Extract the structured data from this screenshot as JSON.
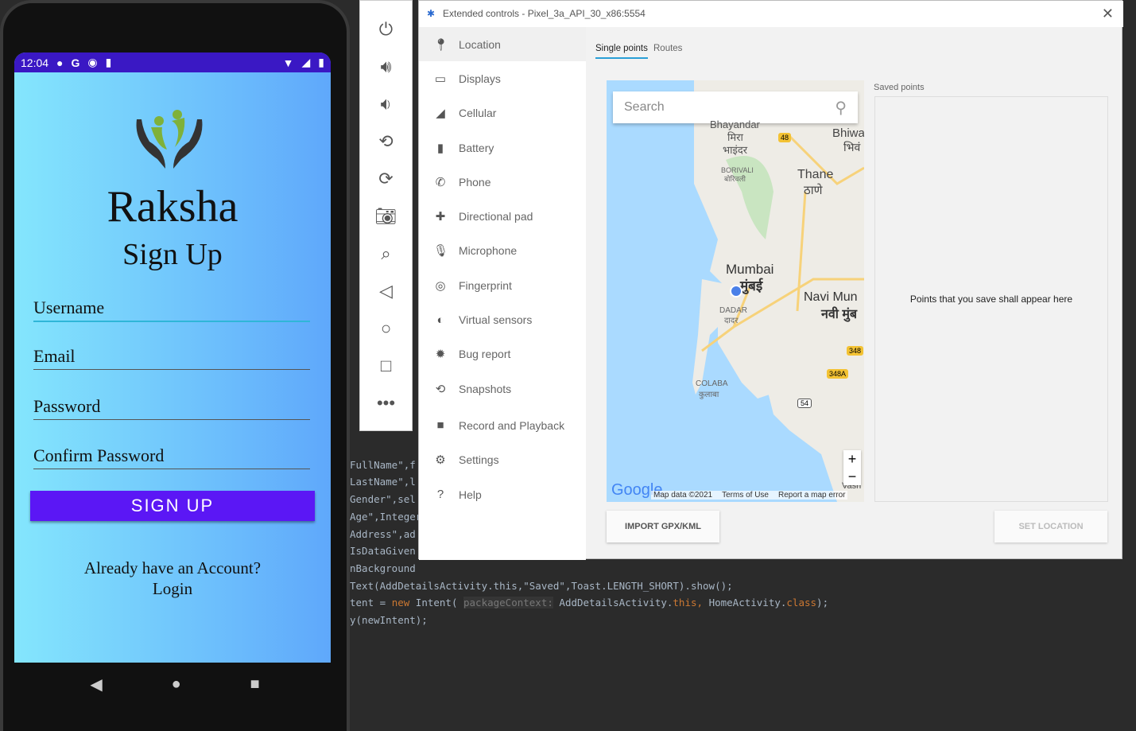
{
  "phone": {
    "time": "12:04",
    "app_name": "Raksha",
    "page_title": "Sign Up",
    "fields": [
      {
        "label": "Username"
      },
      {
        "label": "Email"
      },
      {
        "label": "Password"
      },
      {
        "label": "Confirm Password"
      }
    ],
    "signup_button": "SIGN UP",
    "login_prompt": "Already have an Account?",
    "login_link": "Login"
  },
  "code": {
    "lines": [
      "FullName\",f",
      "LastName\",l",
      "Gender\",sel",
      "Age\",Integer",
      "Address\",ad",
      "IsDataGiven",
      "nBackground"
    ],
    "line_toast": "Text(AddDetailsActivity.this,\"Saved\",Toast.LENGTH_SHORT).show();",
    "line_intent_a": "tent = ",
    "line_intent_new": "new",
    "line_intent_b": " Intent( ",
    "line_intent_hint": "packageContext:",
    "line_intent_c": " AddDetailsActivity.",
    "line_intent_this": "this,",
    "line_intent_d": " HomeActivity.",
    "line_intent_class": "class",
    "line_intent_e": ");",
    "line_start": "y(newIntent);"
  },
  "extended_controls": {
    "title": "Extended controls - Pixel_3a_API_30_x86:5554",
    "menu": [
      {
        "label": "Location",
        "icon": "location-pin-icon"
      },
      {
        "label": "Displays",
        "icon": "display-icon"
      },
      {
        "label": "Cellular",
        "icon": "cellular-icon"
      },
      {
        "label": "Battery",
        "icon": "battery-icon"
      },
      {
        "label": "Phone",
        "icon": "phone-icon"
      },
      {
        "label": "Directional pad",
        "icon": "dpad-icon"
      },
      {
        "label": "Microphone",
        "icon": "microphone-icon"
      },
      {
        "label": "Fingerprint",
        "icon": "fingerprint-icon"
      },
      {
        "label": "Virtual sensors",
        "icon": "sensors-icon"
      },
      {
        "label": "Bug report",
        "icon": "bug-icon"
      },
      {
        "label": "Snapshots",
        "icon": "snapshot-icon"
      },
      {
        "label": "Record and Playback",
        "icon": "video-icon"
      },
      {
        "label": "Settings",
        "icon": "gear-icon"
      },
      {
        "label": "Help",
        "icon": "help-icon"
      }
    ],
    "selected": "Location",
    "tabs": [
      "Single points",
      "Routes"
    ],
    "active_tab": "Single points",
    "search_placeholder": "Search",
    "map_labels": {
      "mumbai": "Mumbai",
      "mumbai_hi": "मुंबई",
      "thane": "Thane",
      "thane_hi": "ठाणे",
      "navi": "Navi Mun",
      "navi_hi": "नवी मुंब",
      "bhiwandi": "Bhiwa",
      "bhiwandi_hi": "भिवं",
      "bhayandar": "Bhayandar",
      "mira_hi": "मिरा",
      "bhayandar_hi": "भाइंदर",
      "borivali": "BORIVALI",
      "borivali_hi": "बोरिवली",
      "dadar": "DADAR",
      "dadar_hi": "दादर",
      "colaba": "COLABA",
      "colaba_hi": "कुलाबा",
      "vashi": "Vash",
      "r48": "48",
      "r348": "348",
      "r348a": "348A",
      "r54": "54"
    },
    "map_footer": {
      "google": "Google",
      "data": "Map data ©2021",
      "terms": "Terms of Use",
      "report": "Report a map error"
    },
    "zoom_in": "+",
    "zoom_out": "−",
    "saved_points_label": "Saved points",
    "saved_points_empty": "Points that you save shall appear here",
    "import_button": "IMPORT GPX/KML",
    "set_location_button": "SET LOCATION"
  }
}
